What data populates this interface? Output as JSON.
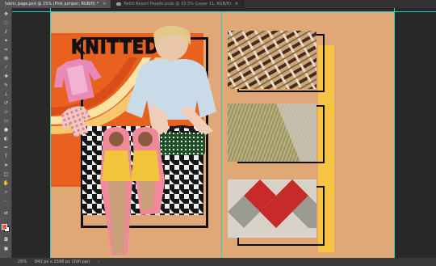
{
  "tabs": [
    {
      "label": "fabric page.psd @ 25% (Pink jumper, RGB/8) *",
      "active": true
    },
    {
      "label": "Retro Resort People.psds @ 33.3% (Layer 11, RGB/8)",
      "active": false
    }
  ],
  "collage": {
    "title": "KNITTED"
  },
  "status": {
    "zoom": "25%",
    "doc_size": "841 px x 2598 px (300 ppi)"
  },
  "colors": {
    "artboard": "#e0a876",
    "orange": "#e9611f",
    "yellow": "#f6c343",
    "guide": "#29d0c0",
    "foreground_swatch": "#e8503a"
  },
  "tools": [
    "move-tool",
    "marquee-tool",
    "lasso-tool",
    "magic-wand-tool",
    "crop-tool",
    "frame-tool",
    "eyedropper-tool",
    "healing-brush-tool",
    "brush-tool",
    "clone-stamp-tool",
    "history-brush-tool",
    "eraser-tool",
    "gradient-tool",
    "blur-tool",
    "dodge-tool",
    "pen-tool",
    "type-tool",
    "path-selection-tool",
    "rectangle-tool",
    "hand-tool",
    "zoom-tool",
    "more-tools"
  ]
}
